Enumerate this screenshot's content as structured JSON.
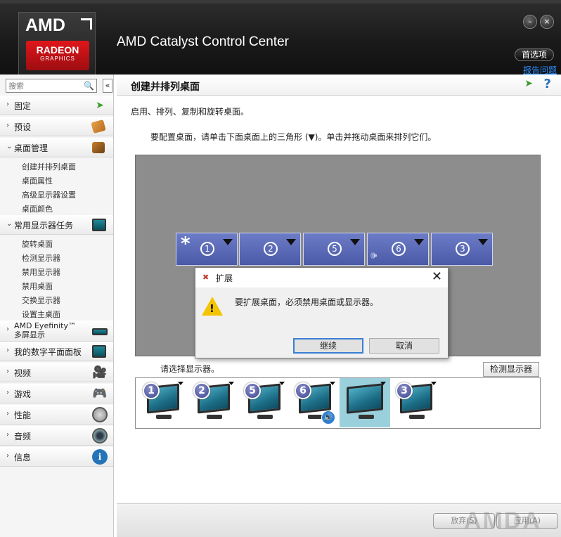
{
  "header": {
    "logo_amd": "AMD",
    "logo_line1": "RADEON",
    "logo_line2": "GRAPHICS",
    "app_title": "AMD Catalyst Control Center",
    "minimize_label": "–",
    "close_label": "×",
    "preferences_label": "首选项",
    "report_label": "报告问题"
  },
  "sidebar": {
    "search_placeholder": "搜索",
    "collapse_label": "«",
    "items": [
      {
        "label": "固定",
        "icon": "pin-icon"
      },
      {
        "label": "预设",
        "icon": "tag-icon"
      },
      {
        "label": "桌面管理",
        "icon": "desktop-management-icon"
      },
      {
        "label": "常用显示器任务",
        "icon": "display-tasks-icon"
      },
      {
        "label": "AMD Eyefinity™",
        "label2": "多屏显示",
        "icon": "eyefinity-icon"
      },
      {
        "label": "我的数字平面面板",
        "icon": "flat-panel-icon"
      },
      {
        "label": "视频",
        "icon": "video-camera-icon"
      },
      {
        "label": "游戏",
        "icon": "gamepad-icon"
      },
      {
        "label": "性能",
        "icon": "gauge-icon"
      },
      {
        "label": "音频",
        "icon": "speaker-icon"
      },
      {
        "label": "信息",
        "icon": "info-icon"
      }
    ],
    "desktop_mgmt_sub": [
      "创建并排列桌面",
      "桌面属性",
      "高级显示器设置",
      "桌面颜色"
    ],
    "display_tasks_sub": [
      "旋转桌面",
      "检测显示器",
      "禁用显示器",
      "禁用桌面",
      "交换显示器",
      "设置主桌面"
    ]
  },
  "main": {
    "title": "创建并排列桌面",
    "help_label": "?",
    "description": "启用、排列、复制和旋转桌面。",
    "instruction": "要配置桌面，请单击下面桌面上的三角形 (▼)。单击并拖动桌面来排列它们。",
    "desktops": [
      {
        "number": "1",
        "primary": true,
        "star": "*"
      },
      {
        "number": "2"
      },
      {
        "number": "5"
      },
      {
        "number": "6",
        "audio": true
      },
      {
        "number": "3"
      }
    ],
    "select_display_label": "请选择显示器。",
    "detect_button": "检测显示器",
    "monitors": [
      {
        "number": "1"
      },
      {
        "number": "2"
      },
      {
        "number": "5"
      },
      {
        "number": "6",
        "audio": true
      },
      {
        "number": "",
        "selected": true
      },
      {
        "number": "3"
      }
    ]
  },
  "dialog": {
    "title": "扩展",
    "message": "要扩展桌面，必须禁用桌面或显示器。",
    "continue_label": "继续",
    "cancel_label": "取消",
    "close_label": "✕"
  },
  "footer": {
    "discard_label": "放弃(S)",
    "apply_label": "应用(A)",
    "watermark": "AMDA"
  },
  "colors": {
    "accent_link": "#2a8cff",
    "desktop_tile": "#5565b5",
    "stage_gray": "#8d8d8d",
    "brand_red": "#e0161b"
  }
}
